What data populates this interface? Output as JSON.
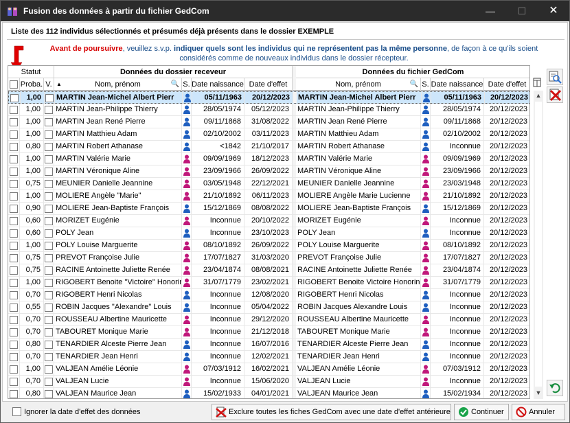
{
  "window": {
    "title": "Fusion des données à partir du fichier GedCom",
    "min_glyph": "—",
    "max_glyph": "☐",
    "close_glyph": "✕"
  },
  "heading": "Liste des 112 individus sélectionnés et présumés déjà présents dans le dossier EXEMPLE",
  "warning": {
    "part1": "Avant de poursuivre",
    "part2": ", veuillez s.v.p. ",
    "part3": "indiquer quels sont les individus qui ne représentent pas la même personne",
    "part4": ", de façon à ce qu'ils soient considérés comme de nouveaux individus dans le dossier récepteur."
  },
  "headers": {
    "status": "Statut",
    "receiver_group": "Données du dossier receveur",
    "gedcom_group": "Données du fichier GedCom",
    "proba": "Proba.",
    "v": "V.",
    "nom": "Nom, prénom",
    "s": "S.",
    "naissance": "Date naissance",
    "effet": "Date d'effet"
  },
  "rows": [
    {
      "proba": "1,00",
      "name": "MARTIN Jean-Michel Albert Pierr",
      "sex": "m",
      "birth": "05/11/1963",
      "effect": "20/12/2023",
      "gname": "MARTIN Jean-Michel Albert Pierr",
      "gsex": "m",
      "gbirth": "05/11/1963",
      "geffect": "20/12/2023"
    },
    {
      "proba": "1,00",
      "name": "MARTIN Jean-Philippe Thierry",
      "sex": "m",
      "birth": "28/05/1974",
      "effect": "05/12/2023",
      "gname": "MARTIN Jean-Philippe Thierry",
      "gsex": "m",
      "gbirth": "28/05/1974",
      "geffect": "20/12/2023"
    },
    {
      "proba": "1,00",
      "name": "MARTIN Jean René Pierre",
      "sex": "m",
      "birth": "09/11/1868",
      "effect": "31/08/2022",
      "gname": "MARTIN Jean René Pierre",
      "gsex": "m",
      "gbirth": "09/11/1868",
      "geffect": "20/12/2023"
    },
    {
      "proba": "1,00",
      "name": "MARTIN Matthieu Adam",
      "sex": "m",
      "birth": "02/10/2002",
      "effect": "03/11/2023",
      "gname": "MARTIN Matthieu Adam",
      "gsex": "m",
      "gbirth": "02/10/2002",
      "geffect": "20/12/2023"
    },
    {
      "proba": "0,80",
      "name": "MARTIN Robert Athanase",
      "sex": "m",
      "birth": "<1842",
      "effect": "21/10/2017",
      "gname": "MARTIN Robert Athanase",
      "gsex": "m",
      "gbirth": "Inconnue",
      "geffect": "20/12/2023"
    },
    {
      "proba": "1,00",
      "name": "MARTIN Valérie Marie",
      "sex": "f",
      "birth": "09/09/1969",
      "effect": "18/12/2023",
      "gname": "MARTIN Valérie Marie",
      "gsex": "f",
      "gbirth": "09/09/1969",
      "geffect": "20/12/2023"
    },
    {
      "proba": "1,00",
      "name": "MARTIN Véronique Aline",
      "sex": "f",
      "birth": "23/09/1966",
      "effect": "26/09/2022",
      "gname": "MARTIN Véronique Aline",
      "gsex": "f",
      "gbirth": "23/09/1966",
      "geffect": "20/12/2023"
    },
    {
      "proba": "0,75",
      "name": "MEUNIER Danielle Jeannine",
      "sex": "f",
      "birth": "03/05/1948",
      "effect": "22/12/2021",
      "gname": "MEUNIER Danielle Jeannine",
      "gsex": "f",
      "gbirth": "23/03/1948",
      "geffect": "20/12/2023"
    },
    {
      "proba": "1,00",
      "name": "MOLIERE Angèle \"Marie\"",
      "sex": "f",
      "birth": "21/10/1892",
      "effect": "06/11/2023",
      "gname": "MOLIERE Angèle Marie Lucienne",
      "gsex": "f",
      "gbirth": "21/10/1892",
      "geffect": "20/12/2023"
    },
    {
      "proba": "0,90",
      "name": "MOLIERE Jean-Baptiste François",
      "sex": "m",
      "birth": "15/12/1869",
      "effect": "08/08/2022",
      "gname": "MOLIERE Jean-Baptiste François",
      "gsex": "m",
      "gbirth": "15/12/1869",
      "geffect": "20/12/2023"
    },
    {
      "proba": "0,60",
      "name": "MORIZET Eugénie",
      "sex": "f",
      "birth": "Inconnue",
      "effect": "20/10/2022",
      "gname": "MORIZET Eugénie",
      "gsex": "f",
      "gbirth": "Inconnue",
      "geffect": "20/12/2023"
    },
    {
      "proba": "0,60",
      "name": "POLY Jean",
      "sex": "m",
      "birth": "Inconnue",
      "effect": "23/10/2023",
      "gname": "POLY Jean",
      "gsex": "m",
      "gbirth": "Inconnue",
      "geffect": "20/12/2023"
    },
    {
      "proba": "1,00",
      "name": "POLY Louise Marguerite",
      "sex": "f",
      "birth": "08/10/1892",
      "effect": "26/09/2022",
      "gname": "POLY Louise Marguerite",
      "gsex": "f",
      "gbirth": "08/10/1892",
      "geffect": "20/12/2023"
    },
    {
      "proba": "0,75",
      "name": "PREVOT Françoise Julie",
      "sex": "f",
      "birth": "17/07/1827",
      "effect": "31/03/2020",
      "gname": "PREVOT Françoise Julie",
      "gsex": "f",
      "gbirth": "17/07/1827",
      "geffect": "20/12/2023"
    },
    {
      "proba": "0,75",
      "name": "RACINE Antoinette Juliette Renée",
      "sex": "f",
      "birth": "23/04/1874",
      "effect": "08/08/2021",
      "gname": "RACINE Antoinette Juliette Renée",
      "gsex": "f",
      "gbirth": "23/04/1874",
      "geffect": "20/12/2023"
    },
    {
      "proba": "1,00",
      "name": "RIGOBERT Benoite \"Victoire\" Honorin",
      "sex": "f",
      "birth": "31/07/1779",
      "effect": "23/02/2021",
      "gname": "RIGOBERT Benoite Victoire Honorine",
      "gsex": "f",
      "gbirth": "31/07/1779",
      "geffect": "20/12/2023"
    },
    {
      "proba": "0,70",
      "name": "RIGOBERT Henri Nicolas",
      "sex": "m",
      "birth": "Inconnue",
      "effect": "12/08/2020",
      "gname": "RIGOBERT Henri Nicolas",
      "gsex": "m",
      "gbirth": "Inconnue",
      "geffect": "20/12/2023"
    },
    {
      "proba": "0,55",
      "name": "ROBIN Jacques \"Alexandre\" Louis",
      "sex": "m",
      "birth": "Inconnue",
      "effect": "05/04/2022",
      "gname": "ROBIN Jacques Alexandre Louis",
      "gsex": "m",
      "gbirth": "Inconnue",
      "geffect": "20/12/2023"
    },
    {
      "proba": "0,70",
      "name": "ROUSSEAU Albertine Mauricette",
      "sex": "f",
      "birth": "Inconnue",
      "effect": "29/12/2020",
      "gname": "ROUSSEAU Albertine Mauricette",
      "gsex": "f",
      "gbirth": "Inconnue",
      "geffect": "20/12/2023"
    },
    {
      "proba": "0,70",
      "name": "TABOURET Monique Marie",
      "sex": "f",
      "birth": "Inconnue",
      "effect": "21/12/2018",
      "gname": "TABOURET Monique Marie",
      "gsex": "f",
      "gbirth": "Inconnue",
      "geffect": "20/12/2023"
    },
    {
      "proba": "0,80",
      "name": "TENARDIER Alceste Pierre Jean",
      "sex": "m",
      "birth": "Inconnue",
      "effect": "16/07/2016",
      "gname": "TENARDIER Alceste Pierre Jean",
      "gsex": "m",
      "gbirth": "Inconnue",
      "geffect": "20/12/2023"
    },
    {
      "proba": "0,70",
      "name": "TENARDIER Jean Henri",
      "sex": "m",
      "birth": "Inconnue",
      "effect": "12/02/2021",
      "gname": "TENARDIER Jean Henri",
      "gsex": "m",
      "gbirth": "Inconnue",
      "geffect": "20/12/2023"
    },
    {
      "proba": "1,00",
      "name": "VALJEAN Amélie Léonie",
      "sex": "f",
      "birth": "07/03/1912",
      "effect": "16/02/2021",
      "gname": "VALJEAN Amélie Léonie",
      "gsex": "f",
      "gbirth": "07/03/1912",
      "geffect": "20/12/2023"
    },
    {
      "proba": "0,70",
      "name": "VALJEAN Lucie",
      "sex": "f",
      "birth": "Inconnue",
      "effect": "15/06/2020",
      "gname": "VALJEAN Lucie",
      "gsex": "f",
      "gbirth": "Inconnue",
      "geffect": "20/12/2023"
    },
    {
      "proba": "0,80",
      "name": "VALJEAN Maurice Jean",
      "sex": "m",
      "birth": "15/02/1933",
      "effect": "04/01/2021",
      "gname": "VALJEAN Maurice Jean",
      "gsex": "m",
      "gbirth": "15/02/1934",
      "geffect": "20/12/2023"
    }
  ],
  "colors": {
    "male": "#1f5fbf",
    "female": "#c0187a",
    "selected_row": "#cde6fb",
    "warning_red": "#d60000",
    "warning_blue": "#1a4e8a"
  },
  "footer": {
    "ignore_label": "Ignorer la date d'effet des données",
    "exclude_label": "Exclure toutes les fiches GedCom avec une date d'effet antérieure",
    "continue_label": "Continuer",
    "cancel_label": "Annuler"
  }
}
